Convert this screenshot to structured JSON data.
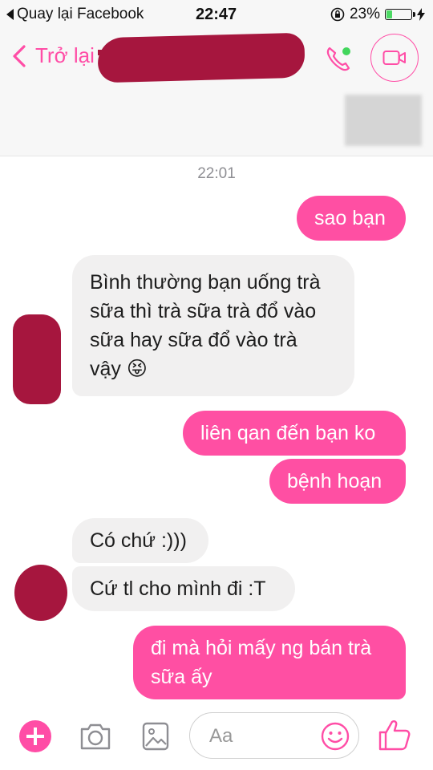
{
  "status_bar": {
    "back_label": "Quay lại Facebook",
    "time": "22:47",
    "battery_percent_text": "23%",
    "battery_level": 0.23
  },
  "nav": {
    "back_label": "Trở lại",
    "contact_name": "",
    "call_icon": "phone-icon",
    "video_icon": "video-camera-icon",
    "accent_color": "#ff4da6"
  },
  "chat": {
    "timestamp": "22:01",
    "messages": [
      {
        "dir": "out",
        "lines": [
          "sao bạn"
        ]
      },
      {
        "dir": "in",
        "lines": [
          "Bình thường bạn uống trà",
          "sữa thì trà sữa trà đổ vào",
          "sữa hay sữa đổ vào trà",
          "vậy 😝"
        ]
      },
      {
        "dir": "out",
        "lines": [
          "liên qan đến bạn ko"
        ]
      },
      {
        "dir": "out",
        "lines": [
          "bệnh hoạn"
        ]
      },
      {
        "dir": "in",
        "lines": [
          "Có chứ :)))"
        ]
      },
      {
        "dir": "in",
        "lines": [
          "Cứ tl cho mình đi :T"
        ]
      },
      {
        "dir": "out",
        "lines": [
          "đi mà hỏi mấy ng bán trà",
          "sữa ấy"
        ]
      }
    ]
  },
  "composer": {
    "placeholder": "Aa",
    "icons": [
      "plus-icon",
      "camera-icon",
      "image-icon",
      "emoji-icon",
      "thumbs-up-icon"
    ]
  }
}
